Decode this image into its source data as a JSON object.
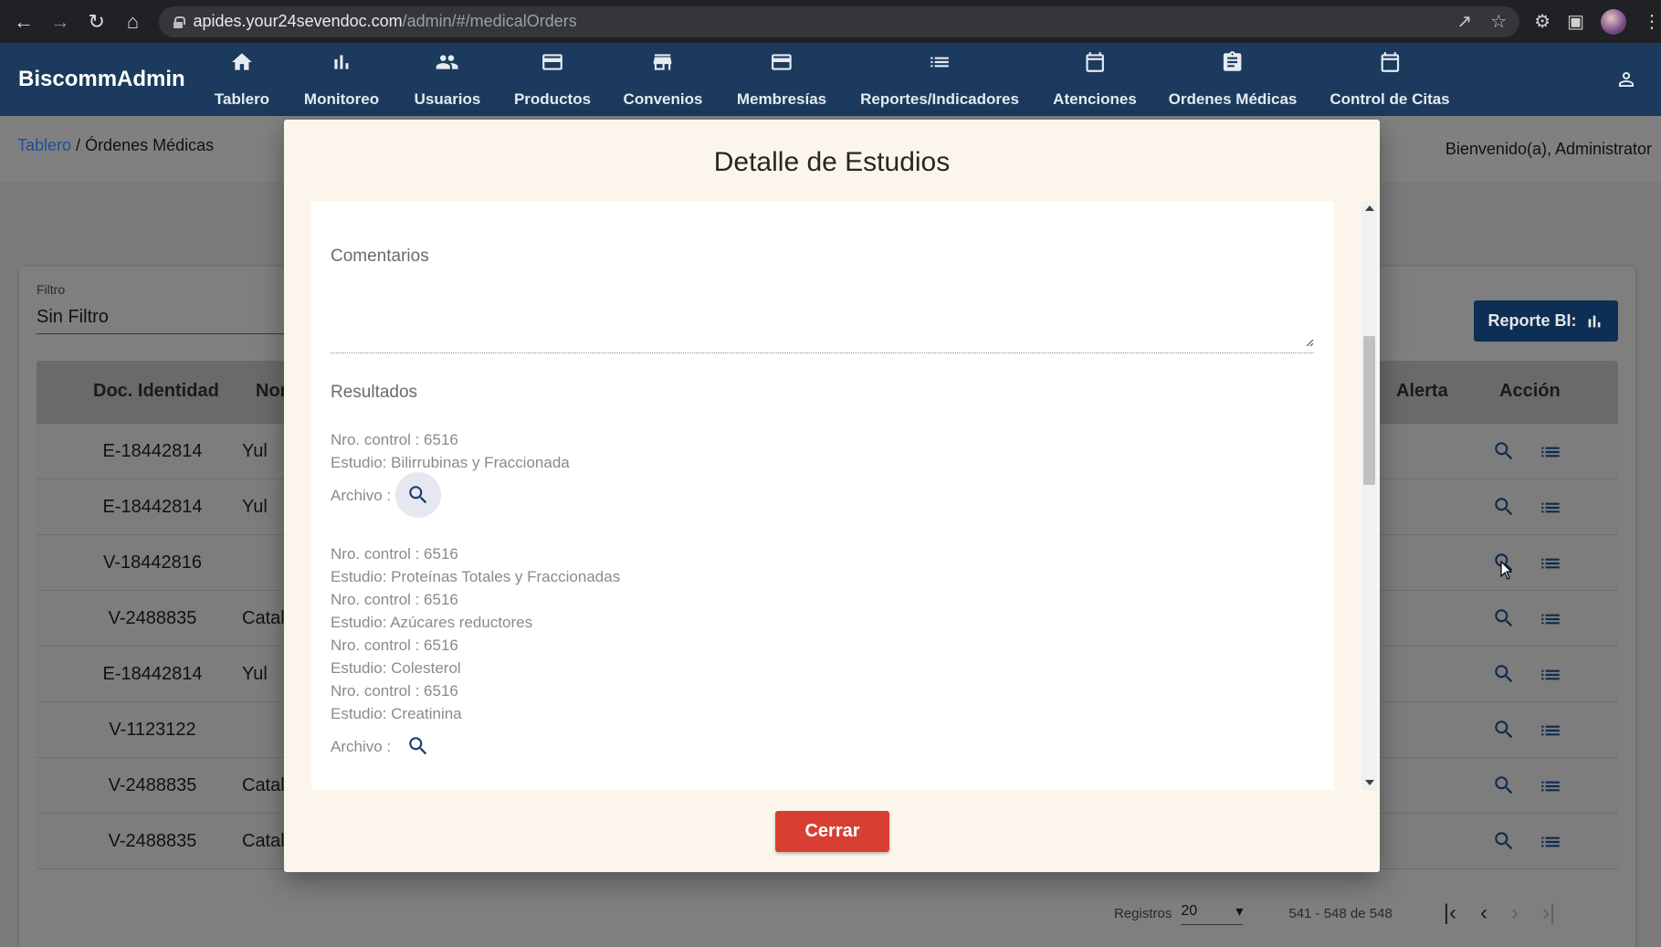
{
  "browser": {
    "url_domain": "apides.your24sevendoc.com",
    "url_path": "/admin/#/medicalOrders"
  },
  "app": {
    "brand": "BiscommAdmin",
    "nav": [
      {
        "label": "Tablero",
        "icon": "home-icon"
      },
      {
        "label": "Monitoreo",
        "icon": "bar-chart-icon"
      },
      {
        "label": "Usuarios",
        "icon": "people-icon"
      },
      {
        "label": "Productos",
        "icon": "card-icon"
      },
      {
        "label": "Convenios",
        "icon": "store-icon"
      },
      {
        "label": "Membresías",
        "icon": "card-icon"
      },
      {
        "label": "Reportes/Indicadores",
        "icon": "list-icon"
      },
      {
        "label": "Atenciones",
        "icon": "calendar-icon"
      },
      {
        "label": "Ordenes Médicas",
        "icon": "clipboard-icon"
      },
      {
        "label": "Control de Citas",
        "icon": "calendar-icon"
      }
    ]
  },
  "breadcrumb": {
    "link": "Tablero",
    "separator": " / ",
    "current": "Órdenes Médicas"
  },
  "welcome": "Bienvenido(a), Administrator",
  "filter": {
    "label": "Filtro",
    "value": "Sin Filtro"
  },
  "report_button": "Reporte BI:",
  "table": {
    "headers": {
      "doc": "Doc. Identidad",
      "name": "Nor",
      "alert": "Alerta",
      "action": "Acción"
    },
    "rows": [
      {
        "doc": "E-18442814",
        "name": "Yul"
      },
      {
        "doc": "E-18442814",
        "name": "Yul"
      },
      {
        "doc": "V-18442816",
        "name": ""
      },
      {
        "doc": "V-2488835",
        "name": "Catal"
      },
      {
        "doc": "E-18442814",
        "name": "Yul"
      },
      {
        "doc": "V-1123122",
        "name": ""
      },
      {
        "doc": "V-2488835",
        "name": "Catal"
      },
      {
        "doc": "V-2488835",
        "name": "Catal"
      }
    ]
  },
  "paginator": {
    "label": "Registros",
    "page_size": "20",
    "range": "541 - 548 de 548"
  },
  "modal": {
    "title": "Detalle de Estudios",
    "comments_label": "Comentarios",
    "results_label": "Resultados",
    "group1": {
      "control": "Nro. control : 6516",
      "study": "Estudio: Bilirrubinas y Fraccionada",
      "file_label": "Archivo :"
    },
    "group2": {
      "lines": [
        "Nro. control : 6516",
        "Estudio: Proteínas Totales y Fraccionadas",
        "Nro. control : 6516",
        "Estudio: Azúcares reductores",
        "Nro. control : 6516",
        "Estudio: Colesterol",
        "Nro. control : 6516",
        "Estudio: Creatinina"
      ],
      "file_label": "Archivo :"
    },
    "close_button": "Cerrar"
  }
}
